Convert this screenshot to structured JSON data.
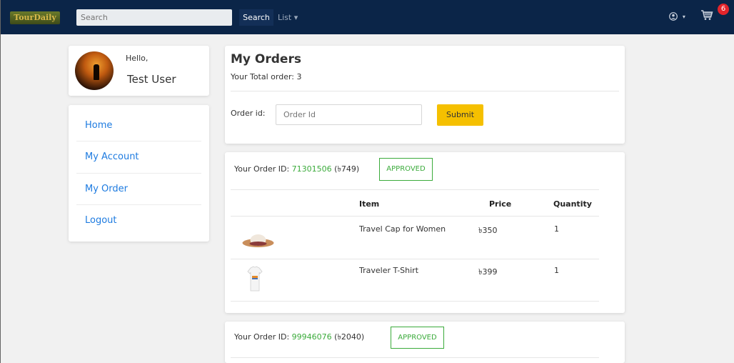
{
  "nav": {
    "logo_text": "TourDaily",
    "search_placeholder": "Search",
    "search_button": "Search",
    "list_menu": "List ▾",
    "cart_count": "6"
  },
  "profile": {
    "greeting": "Hello,",
    "name": "Test User"
  },
  "sidebar": {
    "items": [
      {
        "label": "Home"
      },
      {
        "label": "My Account"
      },
      {
        "label": "My Order"
      },
      {
        "label": "Logout"
      }
    ]
  },
  "orders": {
    "title": "My Orders",
    "total_text": "Your Total order: 3",
    "order_id_label": "Order id:",
    "order_id_placeholder": "Order Id",
    "submit_label": "Submit"
  },
  "order_list": [
    {
      "id_label": "Your Order ID:",
      "id": "71301506",
      "amount": "(৳749)",
      "status": "APPROVED",
      "columns": [
        "Item",
        "Price",
        "Quantity"
      ],
      "items": [
        {
          "name": "Travel Cap for Women",
          "price": "৳350",
          "qty": "1",
          "thumb": "hat"
        },
        {
          "name": "Traveler T-Shirt",
          "price": "৳399",
          "qty": "1",
          "thumb": "tshirt"
        }
      ]
    },
    {
      "id_label": "Your Order ID:",
      "id": "99946076",
      "amount": "(৳2040)",
      "status": "APPROVED"
    }
  ],
  "colors": {
    "navbar": "#0b2548",
    "link": "#1e7be0",
    "accent": "#f5c000",
    "success": "#3bab3b",
    "badge": "#e3242b"
  }
}
